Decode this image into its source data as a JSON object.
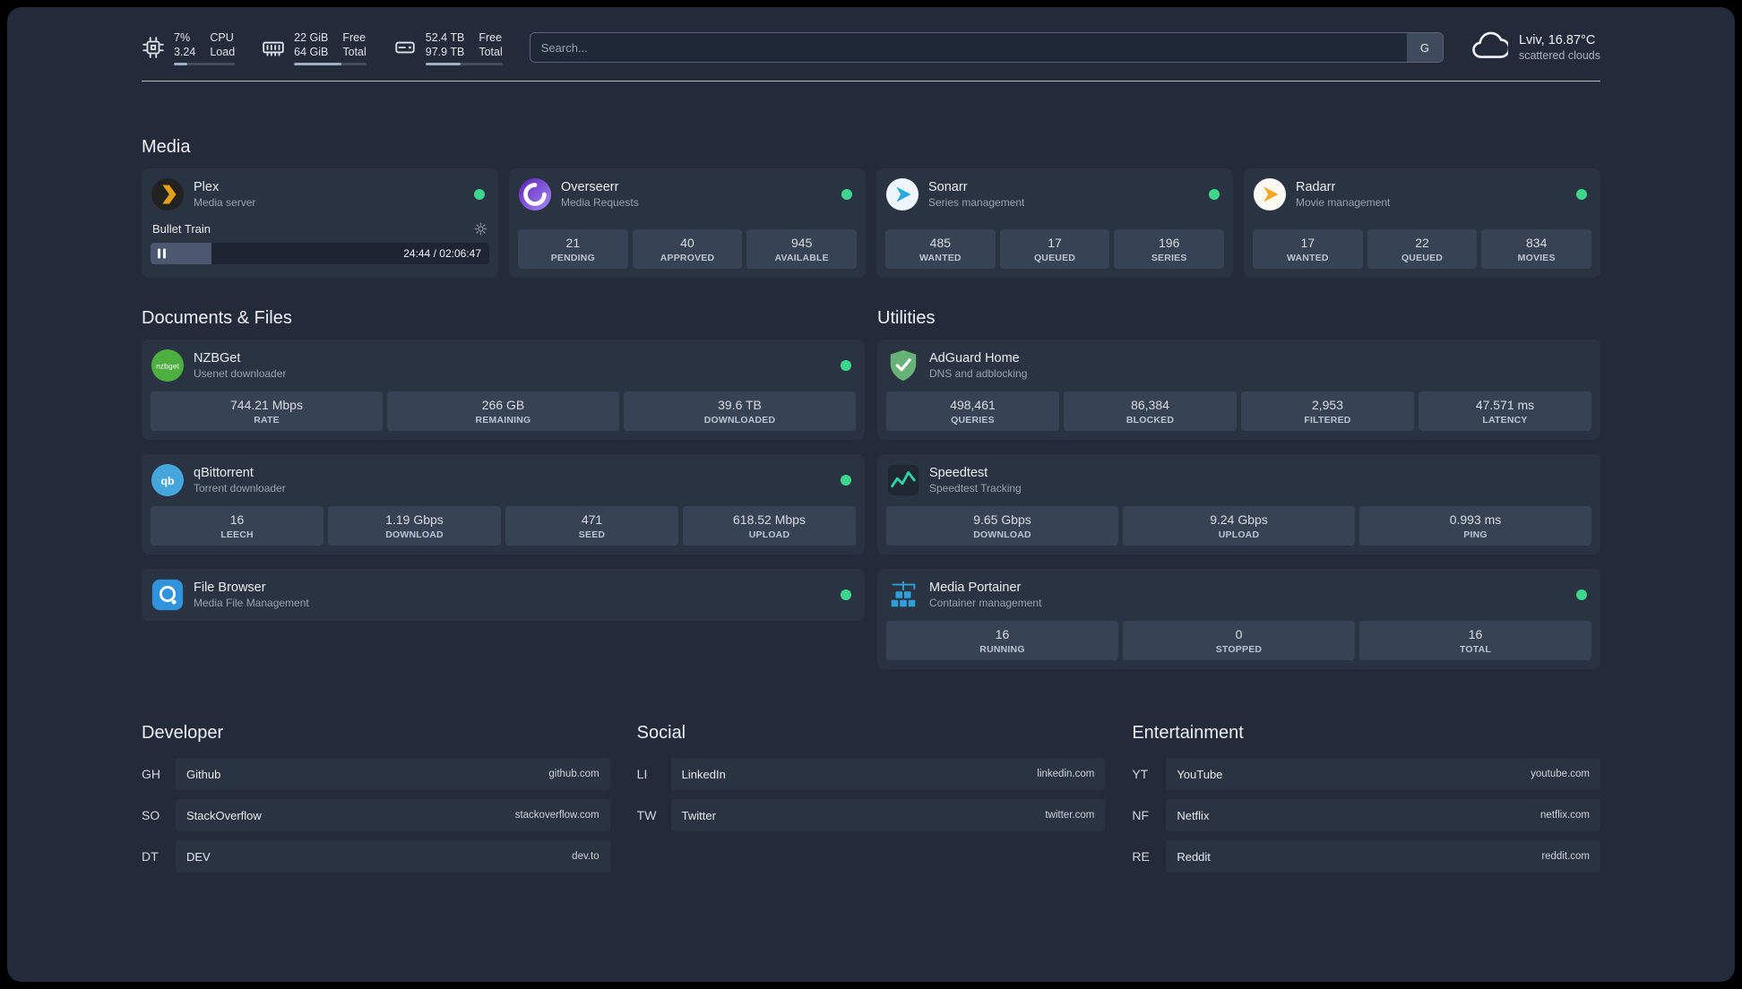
{
  "colors": {
    "background": "#232b3a",
    "card": "#2a3342",
    "stat_box": "#374255",
    "status_online": "#3dd68c",
    "plex_amber": "#e5a00d",
    "progress_fill": "#9fb0c3"
  },
  "topbar": {
    "cpu": {
      "usage": "7%",
      "load": "3.24",
      "label_top": "CPU",
      "label_bottom": "Load",
      "progress_pct": 22
    },
    "memory": {
      "free": "22 GiB",
      "total": "64 GiB",
      "label_top": "Free",
      "label_bottom": "Total",
      "progress_pct": 65
    },
    "disk": {
      "free": "52.4 TB",
      "total": "97.9 TB",
      "label_top": "Free",
      "label_bottom": "Total",
      "progress_pct": 46
    },
    "search": {
      "placeholder": "Search...",
      "provider_button": "G"
    },
    "weather": {
      "location": "Lviv, 16.87°C",
      "condition": "scattered clouds"
    }
  },
  "media": {
    "title": "Media",
    "plex": {
      "name": "Plex",
      "desc": "Media server",
      "now_playing": "Bullet Train",
      "time": "24:44 / 02:06:47",
      "progress_pct": 18
    },
    "cards": [
      {
        "name": "Overseerr",
        "desc": "Media Requests",
        "stats": [
          {
            "value": "21",
            "label": "PENDING"
          },
          {
            "value": "40",
            "label": "APPROVED"
          },
          {
            "value": "945",
            "label": "AVAILABLE"
          }
        ]
      },
      {
        "name": "Sonarr",
        "desc": "Series management",
        "stats": [
          {
            "value": "485",
            "label": "WANTED"
          },
          {
            "value": "17",
            "label": "QUEUED"
          },
          {
            "value": "196",
            "label": "SERIES"
          }
        ]
      },
      {
        "name": "Radarr",
        "desc": "Movie management",
        "stats": [
          {
            "value": "17",
            "label": "WANTED"
          },
          {
            "value": "22",
            "label": "QUEUED"
          },
          {
            "value": "834",
            "label": "MOVIES"
          }
        ]
      }
    ]
  },
  "documents": {
    "title": "Documents & Files",
    "cards": [
      {
        "name": "NZBGet",
        "desc": "Usenet downloader",
        "stats": [
          {
            "value": "744.21 Mbps",
            "label": "RATE"
          },
          {
            "value": "266 GB",
            "label": "REMAINING"
          },
          {
            "value": "39.6 TB",
            "label": "DOWNLOADED"
          }
        ]
      },
      {
        "name": "qBittorrent",
        "desc": "Torrent downloader",
        "stats": [
          {
            "value": "16",
            "label": "LEECH"
          },
          {
            "value": "1.19 Gbps",
            "label": "DOWNLOAD"
          },
          {
            "value": "471",
            "label": "SEED"
          },
          {
            "value": "618.52 Mbps",
            "label": "UPLOAD"
          }
        ]
      },
      {
        "name": "File Browser",
        "desc": "Media File Management",
        "stats": []
      }
    ]
  },
  "utilities": {
    "title": "Utilities",
    "cards": [
      {
        "name": "AdGuard Home",
        "desc": "DNS and adblocking",
        "stats": [
          {
            "value": "498,461",
            "label": "QUERIES"
          },
          {
            "value": "86,384",
            "label": "BLOCKED"
          },
          {
            "value": "2,953",
            "label": "FILTERED"
          },
          {
            "value": "47.571 ms",
            "label": "LATENCY"
          }
        ]
      },
      {
        "name": "Speedtest",
        "desc": "Speedtest Tracking",
        "stats": [
          {
            "value": "9.65 Gbps",
            "label": "DOWNLOAD"
          },
          {
            "value": "9.24 Gbps",
            "label": "UPLOAD"
          },
          {
            "value": "0.993 ms",
            "label": "PING"
          }
        ]
      },
      {
        "name": "Media Portainer",
        "desc": "Container management",
        "stats": [
          {
            "value": "16",
            "label": "RUNNING"
          },
          {
            "value": "0",
            "label": "STOPPED"
          },
          {
            "value": "16",
            "label": "TOTAL"
          }
        ]
      }
    ]
  },
  "bookmarks": {
    "groups": [
      {
        "title": "Developer",
        "items": [
          {
            "abbr": "GH",
            "label": "Github",
            "domain": "github.com"
          },
          {
            "abbr": "SO",
            "label": "StackOverflow",
            "domain": "stackoverflow.com"
          },
          {
            "abbr": "DT",
            "label": "DEV",
            "domain": "dev.to"
          }
        ]
      },
      {
        "title": "Social",
        "items": [
          {
            "abbr": "LI",
            "label": "LinkedIn",
            "domain": "linkedin.com"
          },
          {
            "abbr": "TW",
            "label": "Twitter",
            "domain": "twitter.com"
          }
        ]
      },
      {
        "title": "Entertainment",
        "items": [
          {
            "abbr": "YT",
            "label": "YouTube",
            "domain": "youtube.com"
          },
          {
            "abbr": "NF",
            "label": "Netflix",
            "domain": "netflix.com"
          },
          {
            "abbr": "RE",
            "label": "Reddit",
            "domain": "reddit.com"
          }
        ]
      }
    ]
  }
}
